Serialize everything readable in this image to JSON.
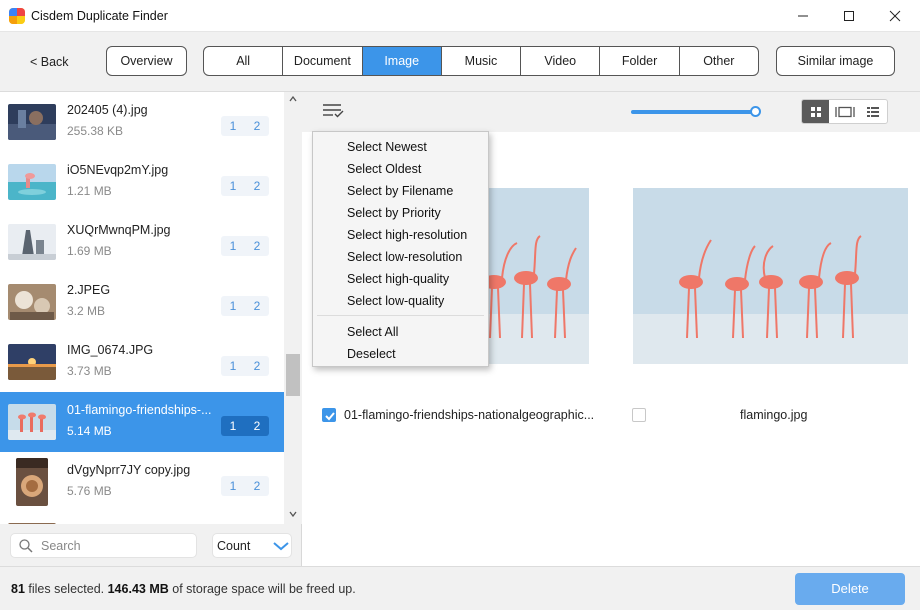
{
  "window": {
    "title": "Cisdem Duplicate Finder"
  },
  "toolbar": {
    "back_label": "< Back",
    "overview_label": "Overview",
    "similar_label": "Similar image",
    "tabs": [
      {
        "label": "All",
        "active": false
      },
      {
        "label": "Document",
        "active": false
      },
      {
        "label": "Image",
        "active": true
      },
      {
        "label": "Music",
        "active": false
      },
      {
        "label": "Video",
        "active": false
      },
      {
        "label": "Folder",
        "active": false
      },
      {
        "label": "Other",
        "active": false
      }
    ]
  },
  "file_list": {
    "items": [
      {
        "name": "202405 (4).jpg",
        "size": "255.38 KB",
        "copy1": "1",
        "copy2": "2",
        "selected": false
      },
      {
        "name": "iO5NEvqp2mY.jpg",
        "size": "1.21 MB",
        "copy1": "1",
        "copy2": "2",
        "selected": false
      },
      {
        "name": "XUQrMwnqPM.jpg",
        "size": "1.69 MB",
        "copy1": "1",
        "copy2": "2",
        "selected": false
      },
      {
        "name": "2.JPEG",
        "size": "3.2 MB",
        "copy1": "1",
        "copy2": "2",
        "selected": false
      },
      {
        "name": "IMG_0674.JPG",
        "size": "3.73 MB",
        "copy1": "1",
        "copy2": "2",
        "selected": false
      },
      {
        "name": "01-flamingo-friendships-...",
        "size": "5.14 MB",
        "copy1": "1",
        "copy2": "2",
        "selected": true
      },
      {
        "name": "dVgyNprr7JY copy.jpg",
        "size": "5.76 MB",
        "copy1": "1",
        "copy2": "2",
        "selected": false
      }
    ],
    "search_placeholder": "Search",
    "sort_value": "Count"
  },
  "viewer": {
    "view_modes": [
      "grid",
      "compare",
      "list"
    ],
    "active_view": "grid",
    "files": [
      {
        "name": "01-flamingo-friendships-nationalgeographic...",
        "checked": true
      },
      {
        "name": "flamingo.jpg",
        "checked": false
      }
    ]
  },
  "select_menu": {
    "items": [
      "Select Newest",
      "Select Oldest",
      "Select by Filename",
      "Select by Priority",
      "Select high-resolution",
      "Select low-resolution",
      "Select high-quality",
      "Select low-quality",
      "Select All",
      "Deselect"
    ]
  },
  "footer": {
    "files_count": "81",
    "files_text": "files selected.",
    "size": "146.43 MB",
    "size_text": "of storage space will be freed up.",
    "delete_label": "Delete"
  },
  "colors": {
    "accent": "#3c95e9",
    "delete": "#69abee"
  }
}
